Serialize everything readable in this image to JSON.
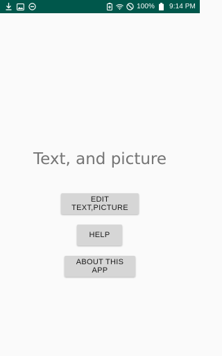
{
  "status_bar": {
    "battery_percent": "100%",
    "time": "9:14 PM",
    "background_color": "#00574b",
    "left_icons": [
      "download-icon",
      "image-icon",
      "blocked-icon"
    ],
    "right_icons": [
      "battery-saver-icon",
      "wifi-icon",
      "do-not-disturb-icon",
      "battery-icon"
    ]
  },
  "main": {
    "title": "Text, and picture",
    "buttons": {
      "edit": "EDIT TEXT,PICTURE",
      "help": "HELP",
      "about": "ABOUT THIS APP"
    }
  }
}
